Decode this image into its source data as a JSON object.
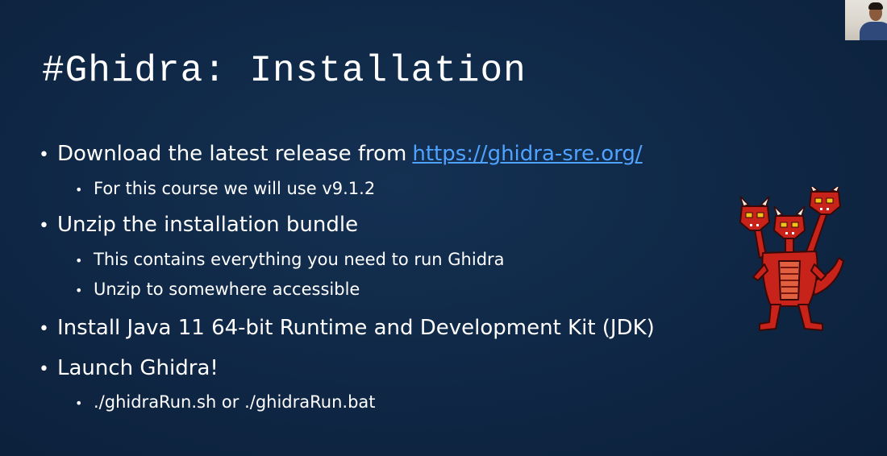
{
  "slide": {
    "title": "#Ghidra: Installation",
    "bullets": [
      {
        "text": "Download the latest release from",
        "link": "https://ghidra-sre.org/",
        "subs": [
          "For this course we will use v9.1.2"
        ]
      },
      {
        "text": "Unzip the installation bundle",
        "subs": [
          "This contains everything you need to run Ghidra",
          "Unzip to somewhere accessible"
        ]
      },
      {
        "text": "Install Java 11 64-bit Runtime and Development Kit (JDK)",
        "subs": []
      },
      {
        "text": "Launch Ghidra!",
        "subs": [
          "./ghidraRun.sh or ./ghidraRun.bat"
        ]
      }
    ]
  },
  "colors": {
    "background": "#0f2745",
    "link": "#4fa3ff",
    "dragon_red": "#c8231a",
    "dragon_dark": "#5a0c08",
    "dragon_yellow": "#f2c21a"
  },
  "icons": {
    "bullet": "•",
    "logo": "ghidra-dragon-logo",
    "webcam": "presenter-webcam"
  }
}
